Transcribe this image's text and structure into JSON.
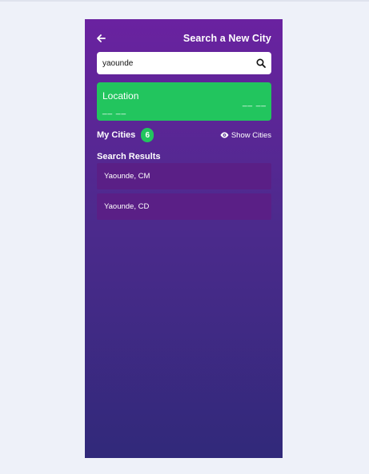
{
  "header": {
    "title": "Search a New City",
    "back_icon": "arrow-left-icon"
  },
  "search": {
    "value": "yaounde",
    "placeholder": "",
    "icon": "search-icon"
  },
  "location_card": {
    "title": "Location",
    "left_value": "__ __",
    "right_value": "__ __",
    "color": "#22c55e"
  },
  "my_cities": {
    "label": "My Cities",
    "count": "6",
    "show_label": "Show Cities",
    "show_icon": "eye-icon"
  },
  "results": {
    "heading": "Search Results",
    "items": [
      {
        "label": "Yaounde, CM"
      },
      {
        "label": "Yaounde, CD"
      }
    ]
  },
  "colors": {
    "gradient_top": "#6a22a0",
    "gradient_bottom": "#31297a",
    "accent": "#22c55e",
    "result_bg": "#5a1f86"
  }
}
